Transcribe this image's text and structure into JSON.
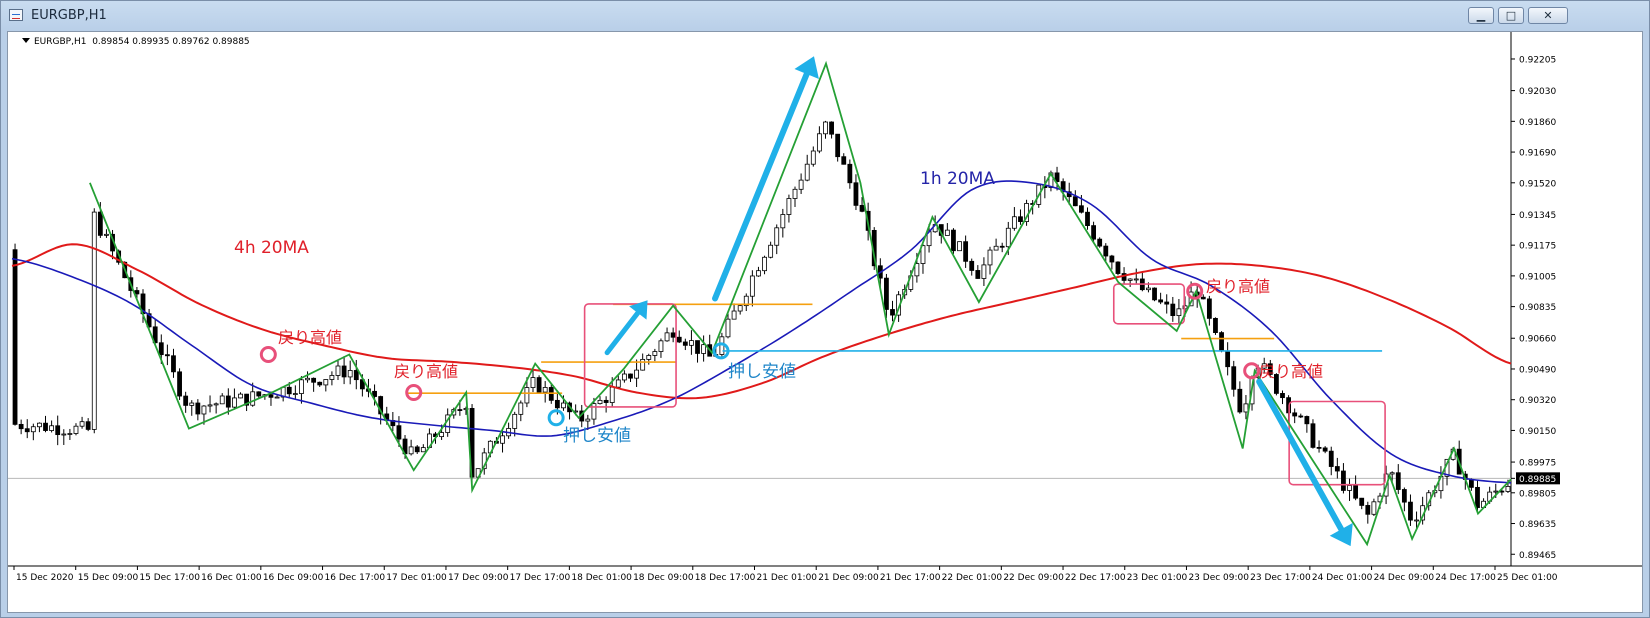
{
  "window": {
    "title": "EURGBP,H1",
    "buttons": {
      "minimize": "▁",
      "maximize": "□",
      "close": "✕"
    }
  },
  "header": {
    "symbol": "EURGBP,H1",
    "ohlc": "0.89854 0.89935 0.89762 0.89885"
  },
  "colors": {
    "background": "#ffffff",
    "candle": "#000000",
    "ma_4h": "#e01a1a",
    "ma_1h": "#1a1ab8",
    "zigzag": "#25a035",
    "orange_lines": "#f5a010",
    "cyan_line": "#20b0e8",
    "pink_box": "#e8507a",
    "current_price_bg": "#000000"
  },
  "annotations": {
    "ma4h": "4h 20MA",
    "ma1h": "1h 20MA",
    "pullback_high": "戻り高値",
    "pullback_low": "押し安値"
  },
  "chart_data": {
    "type": "line",
    "title": "EURGBP,H1",
    "xlabel": "",
    "ylabel": "",
    "ylim": [
      0.894,
      0.9231
    ],
    "grid": false,
    "x_tick_labels": [
      "15 Dec 2020",
      "15 Dec 09:00",
      "15 Dec 17:00",
      "16 Dec 01:00",
      "16 Dec 09:00",
      "16 Dec 17:00",
      "17 Dec 01:00",
      "17 Dec 09:00",
      "17 Dec 17:00",
      "18 Dec 01:00",
      "18 Dec 09:00",
      "18 Dec 17:00",
      "21 Dec 01:00",
      "21 Dec 09:00",
      "21 Dec 17:00",
      "22 Dec 01:00",
      "22 Dec 09:00",
      "22 Dec 17:00",
      "23 Dec 01:00",
      "23 Dec 09:00",
      "23 Dec 17:00",
      "24 Dec 01:00",
      "24 Dec 09:00",
      "24 Dec 17:00",
      "25 Dec 01:00"
    ],
    "y_tick_labels": [
      "0.92205",
      "0.92030",
      "0.91860",
      "0.91690",
      "0.91520",
      "0.91345",
      "0.91175",
      "0.91005",
      "0.90835",
      "0.90660",
      "0.90490",
      "0.90320",
      "0.90150",
      "0.89975",
      "0.89885",
      "0.89805",
      "0.89635",
      "0.89465"
    ],
    "current_price": 0.89885,
    "series": [
      {
        "type": "line",
        "values": [
          0.911,
          0.91,
          0.9085,
          0.9062,
          0.904,
          0.903,
          0.9022,
          0.9018,
          0.9015,
          0.9012,
          0.902,
          0.9032,
          0.905,
          0.907,
          0.9092,
          0.9115,
          0.9148,
          0.9152,
          0.914,
          0.911,
          0.9095,
          0.907,
          0.9032,
          0.9002,
          0.899,
          0.8986
        ]
      },
      {
        "type": "line",
        "values": [
          0.9106,
          0.9118,
          0.9104,
          0.9085,
          0.9071,
          0.9062,
          0.9055,
          0.9053,
          0.905,
          0.9045,
          0.9036,
          0.9033,
          0.9041,
          0.9056,
          0.9068,
          0.9078,
          0.9086,
          0.9094,
          0.9102,
          0.9107,
          0.9106,
          0.91,
          0.9088,
          0.9072,
          0.9052
        ]
      },
      {
        "type": "line",
        "values": [
          0.9152,
          0.9016,
          0.9035,
          0.9057,
          0.8993,
          0.9036,
          0.8982,
          0.9052,
          0.9022,
          0.9049,
          0.9084,
          0.9058,
          0.9218,
          0.9152,
          0.9068,
          0.9133,
          0.9086,
          0.9157,
          0.9097,
          0.907,
          0.9092,
          0.9005,
          0.9048,
          0.8952,
          0.899,
          0.8955,
          0.9005,
          0.8969,
          0.8988
        ]
      }
    ],
    "horizontal_levels": [
      0.90356,
      0.90528,
      0.90848,
      0.90658,
      0.9059
    ],
    "markers": [
      0.9057,
      0.9036,
      0.9022,
      0.9059,
      0.9092,
      0.9048
    ]
  }
}
